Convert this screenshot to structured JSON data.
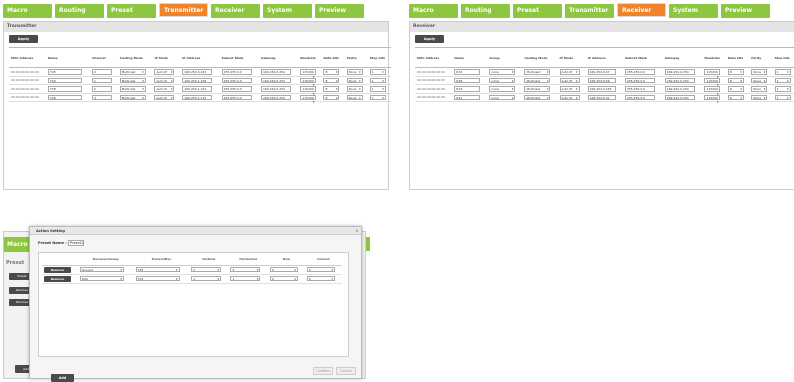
{
  "tx_panel": {
    "tabs": [
      "Macro",
      "Routing",
      "Preset",
      "Transmitter",
      "Receiver",
      "System",
      "Preview"
    ],
    "active_tab": "Transmitter",
    "title": "Transmitter",
    "apply_label": "Apply",
    "columns": [
      "MAC Address",
      "Name",
      "Channel",
      "Casting Mode",
      "IP Mode",
      "IP Address",
      "Subnet Mask",
      "Gateway",
      "Baudrate",
      "Data bits",
      "Parity",
      "Stop bits"
    ],
    "rows": [
      {
        "mac": "00:00:00:00:00:00",
        "name": "TX5",
        "channel": "0",
        "casting": "Multicast",
        "ipmode": "Auto IP",
        "ip": "169.254.3.123",
        "subnet": "255.255.0.0",
        "gateway": "169.254.0.254",
        "baud": "115200",
        "data": "8",
        "parity": "None",
        "stop": "1"
      },
      {
        "mac": "00:00:00:00:00:00",
        "name": "TX9",
        "channel": "1",
        "casting": "Multicast",
        "ipmode": "Auto IP",
        "ip": "169.254.1.108",
        "subnet": "255.255.0.0",
        "gateway": "169.254.0.254",
        "baud": "115200",
        "data": "8",
        "parity": "None",
        "stop": "1"
      },
      {
        "mac": "00:00:00:00:00:00",
        "name": "TX8",
        "channel": "2",
        "casting": "Multicast",
        "ipmode": "Auto IP",
        "ip": "169.254.1.123",
        "subnet": "255.255.0.0",
        "gateway": "169.254.0.254",
        "baud": "115200",
        "data": "8",
        "parity": "None",
        "stop": "1"
      },
      {
        "mac": "00:00:00:00:00:00",
        "name": "TX6",
        "channel": "3",
        "casting": "Multicast",
        "ipmode": "Auto IP",
        "ip": "169.254.1.115",
        "subnet": "255.255.0.0",
        "gateway": "169.254.0.254",
        "baud": "115200",
        "data": "8",
        "parity": "None",
        "stop": "1"
      }
    ]
  },
  "rx_panel": {
    "tabs": [
      "Macro",
      "Routing",
      "Preset",
      "Transmitter",
      "Receiver",
      "System",
      "Preview"
    ],
    "active_tab": "Receiver",
    "title": "Receiver",
    "apply_label": "Apply",
    "columns": [
      "MAC Address",
      "Name",
      "Group",
      "Casting Mode",
      "IP Mode",
      "IP Address",
      "Subnet Mask",
      "Gateway",
      "Baudrate",
      "Data bits",
      "Parity",
      "Stop bits"
    ],
    "rows": [
      {
        "mac": "00:00:00:00:00:00",
        "name": "RX2",
        "group": "none",
        "casting": "Multicast",
        "ipmode": "Auto IP",
        "ip": "169.254.6.97",
        "subnet": "255.255.0.0",
        "gateway": "169.254.0.254",
        "baud": "115200",
        "data": "8",
        "parity": "None",
        "stop": "1"
      },
      {
        "mac": "00:00:00:00:00:00",
        "name": "RX6",
        "group": "none",
        "casting": "Multicast",
        "ipmode": "Auto IP",
        "ip": "169.254.6.56",
        "subnet": "255.255.0.0",
        "gateway": "169.254.0.254",
        "baud": "115200",
        "data": "8",
        "parity": "None",
        "stop": "1"
      },
      {
        "mac": "00:00:00:00:00:00",
        "name": "RX3",
        "group": "none",
        "casting": "Multicast",
        "ipmode": "Auto IP",
        "ip": "169.254.0.254",
        "subnet": "255.255.0.0",
        "gateway": "169.254.0.254",
        "baud": "115200",
        "data": "8",
        "parity": "None",
        "stop": "1"
      },
      {
        "mac": "00:00:00:00:00:00",
        "name": "RX1",
        "group": "none",
        "casting": "Multicast",
        "ipmode": "Auto IP",
        "ip": "169.254.6.41",
        "subnet": "255.255.0.0",
        "gateway": "169.254.0.254",
        "baud": "115200",
        "data": "8",
        "parity": "None",
        "stop": "1"
      }
    ]
  },
  "preset_bg": {
    "tab": "Macro",
    "title": "Preset",
    "btn_preset": "Preset",
    "btn_remove1": "Remove",
    "btn_remove2": "Remove",
    "btn_add": "Add"
  },
  "modal": {
    "title": "Action Setting",
    "close": "x",
    "preset_name_label": "Preset Name :",
    "preset_name_value": "Preset1",
    "columns": [
      "",
      "Receiver/Group",
      "Transmitter",
      "Vertical",
      "Horizontal",
      "Row",
      "Column"
    ],
    "rows": [
      {
        "remove": "Remove",
        "receiver": "Group4",
        "transmitter": "TX5",
        "vertical": "2",
        "horizontal": "2",
        "row": "0",
        "column": "0"
      },
      {
        "remove": "Remove",
        "receiver": "RX6",
        "transmitter": "TX9",
        "vertical": "1",
        "horizontal": "1",
        "row": "0",
        "column": "0"
      }
    ],
    "add_label": "Add",
    "confirm_label": "Confirm",
    "cancel_label": "Cancel"
  }
}
